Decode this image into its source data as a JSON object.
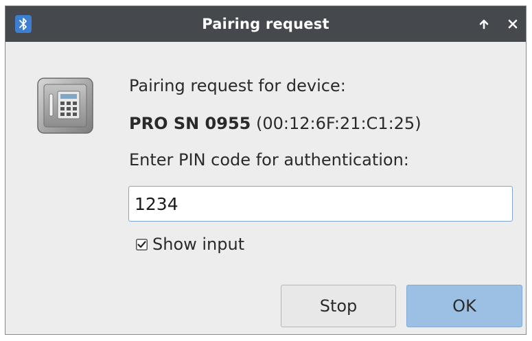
{
  "window": {
    "title": "Pairing request",
    "icon": "bluetooth-icon",
    "controls": [
      "maximize-up-icon",
      "close-icon"
    ]
  },
  "dialog": {
    "icon": "safe-icon",
    "heading": "Pairing request for device:",
    "device_name": "PRO SN 0955",
    "device_address": "(00:12:6F:21:C1:25)",
    "prompt": "Enter PIN code for authentication:",
    "pin_value": "1234",
    "show_input_label": "Show input",
    "show_input_checked": true
  },
  "buttons": {
    "stop_label": "Stop",
    "ok_label": "OK"
  },
  "colors": {
    "titlebar": "#45494d",
    "window_bg": "#ededed",
    "ok_button": "#9cbfe4",
    "input_border": "#7ea6d4"
  }
}
